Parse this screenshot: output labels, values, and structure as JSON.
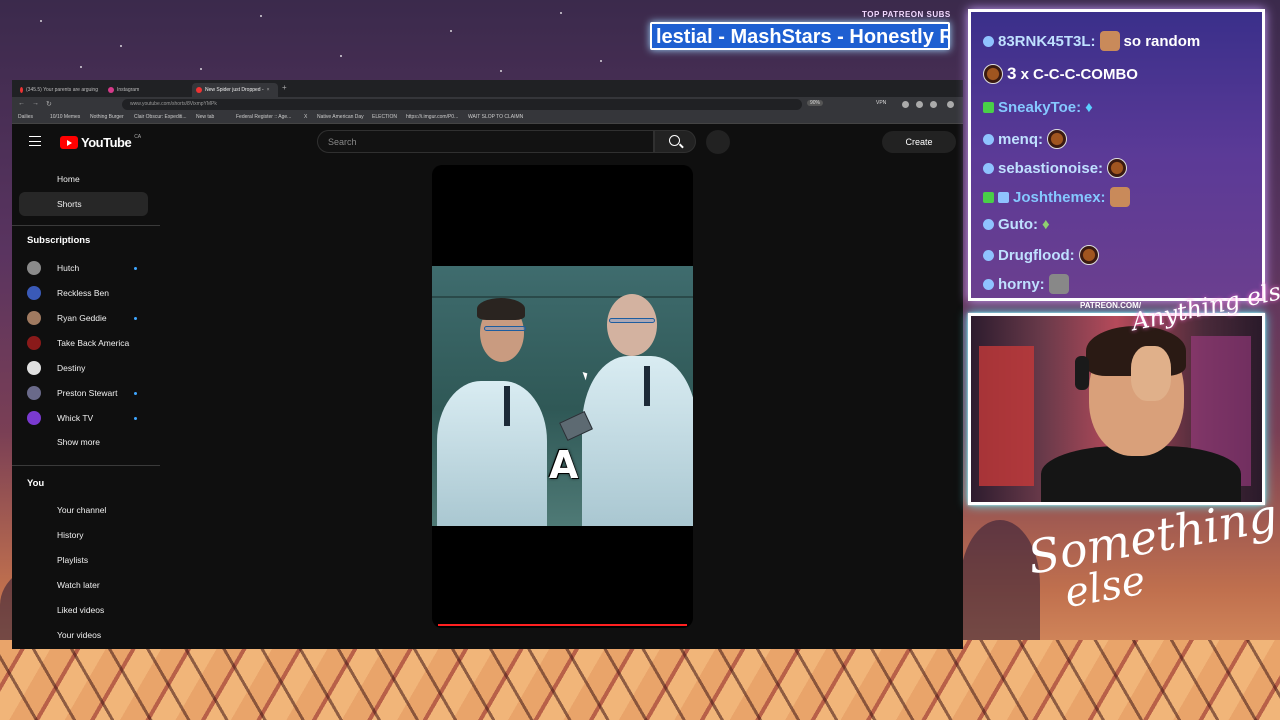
{
  "stream_overlay": {
    "patreon_subs_label": "TOP PATREON SUBS",
    "patreon_subs_ticker": "lestial - MashStars - Honestly Rec",
    "cam_label": "PATREON.COM/",
    "cam_signature": "Anything else?",
    "brand_line1": "Something",
    "brand_line2": "else"
  },
  "browser": {
    "tabs": [
      {
        "label": "(345.5) Your parents are arguing"
      },
      {
        "label": "Instagram"
      },
      {
        "label": "New Spider just Dropped -",
        "active": true
      }
    ],
    "url": "www.youtube.com/shorts/8VixmpYMPk",
    "zoom": "90%",
    "vpn_label": "VPN",
    "bookmarks": [
      "Dailies",
      "10/10 Memes",
      "Nothing Burger",
      "Clair Obscur: Expediti...",
      "New tab",
      "Federal Register :: Age...",
      "X",
      "Native American Day",
      "ELECTION",
      "https://i.imgur.com/P0...",
      "WAIT SLOP TO CLAIMN"
    ]
  },
  "youtube": {
    "logo_text": "YouTube",
    "country_code": "CA",
    "search_placeholder": "Search",
    "create_label": "Create",
    "nav": [
      {
        "label": "Home"
      },
      {
        "label": "Shorts",
        "active": true
      }
    ],
    "subscriptions_title": "Subscriptions",
    "subscriptions": [
      {
        "name": "Hutch",
        "new": true,
        "color": "#8a8a8a"
      },
      {
        "name": "Reckless Ben",
        "new": false,
        "color": "#3a5ab8"
      },
      {
        "name": "Ryan Geddie",
        "new": true,
        "color": "#a07a60"
      },
      {
        "name": "Take Back America",
        "new": false,
        "color": "#8a1a1a"
      },
      {
        "name": "Destiny",
        "new": false,
        "color": "#e0e0e0"
      },
      {
        "name": "Preston Stewart",
        "new": true,
        "color": "#6a6a8a"
      },
      {
        "name": "Whick TV",
        "new": true,
        "color": "#7a3ad0"
      }
    ],
    "show_more": "Show more",
    "you_title": "You",
    "you_items": [
      "Your channel",
      "History",
      "Playlists",
      "Watch later",
      "Liked videos",
      "Your videos"
    ],
    "short": {
      "caption": "A",
      "progress": 1.0
    }
  },
  "chat": {
    "messages": [
      {
        "user": "83RNK45T3L:",
        "text": "so random",
        "emote": "face"
      },
      {
        "combo_count": "3",
        "combo_x": "x",
        "text": "C-C-C-COMBO",
        "emote": "cookie"
      },
      {
        "user": "SneakyToe:",
        "text": "",
        "emote": "figure"
      },
      {
        "user": "menq:",
        "text": "",
        "emote": "cookie"
      },
      {
        "user": "sebastionoise:",
        "text": "",
        "emote": "cookie"
      },
      {
        "user": "Joshthemex:",
        "text": "",
        "emote": "face"
      },
      {
        "user": "Guto:",
        "text": "",
        "emote": "figure"
      },
      {
        "user": "Drugflood:",
        "text": "",
        "emote": "cookie"
      },
      {
        "user": "horny:",
        "text": "",
        "emote": "face"
      }
    ]
  },
  "colors": {
    "accent_red": "#ff0000",
    "chat_border": "#ffffff",
    "cam_glow": "#5bf3ff"
  }
}
